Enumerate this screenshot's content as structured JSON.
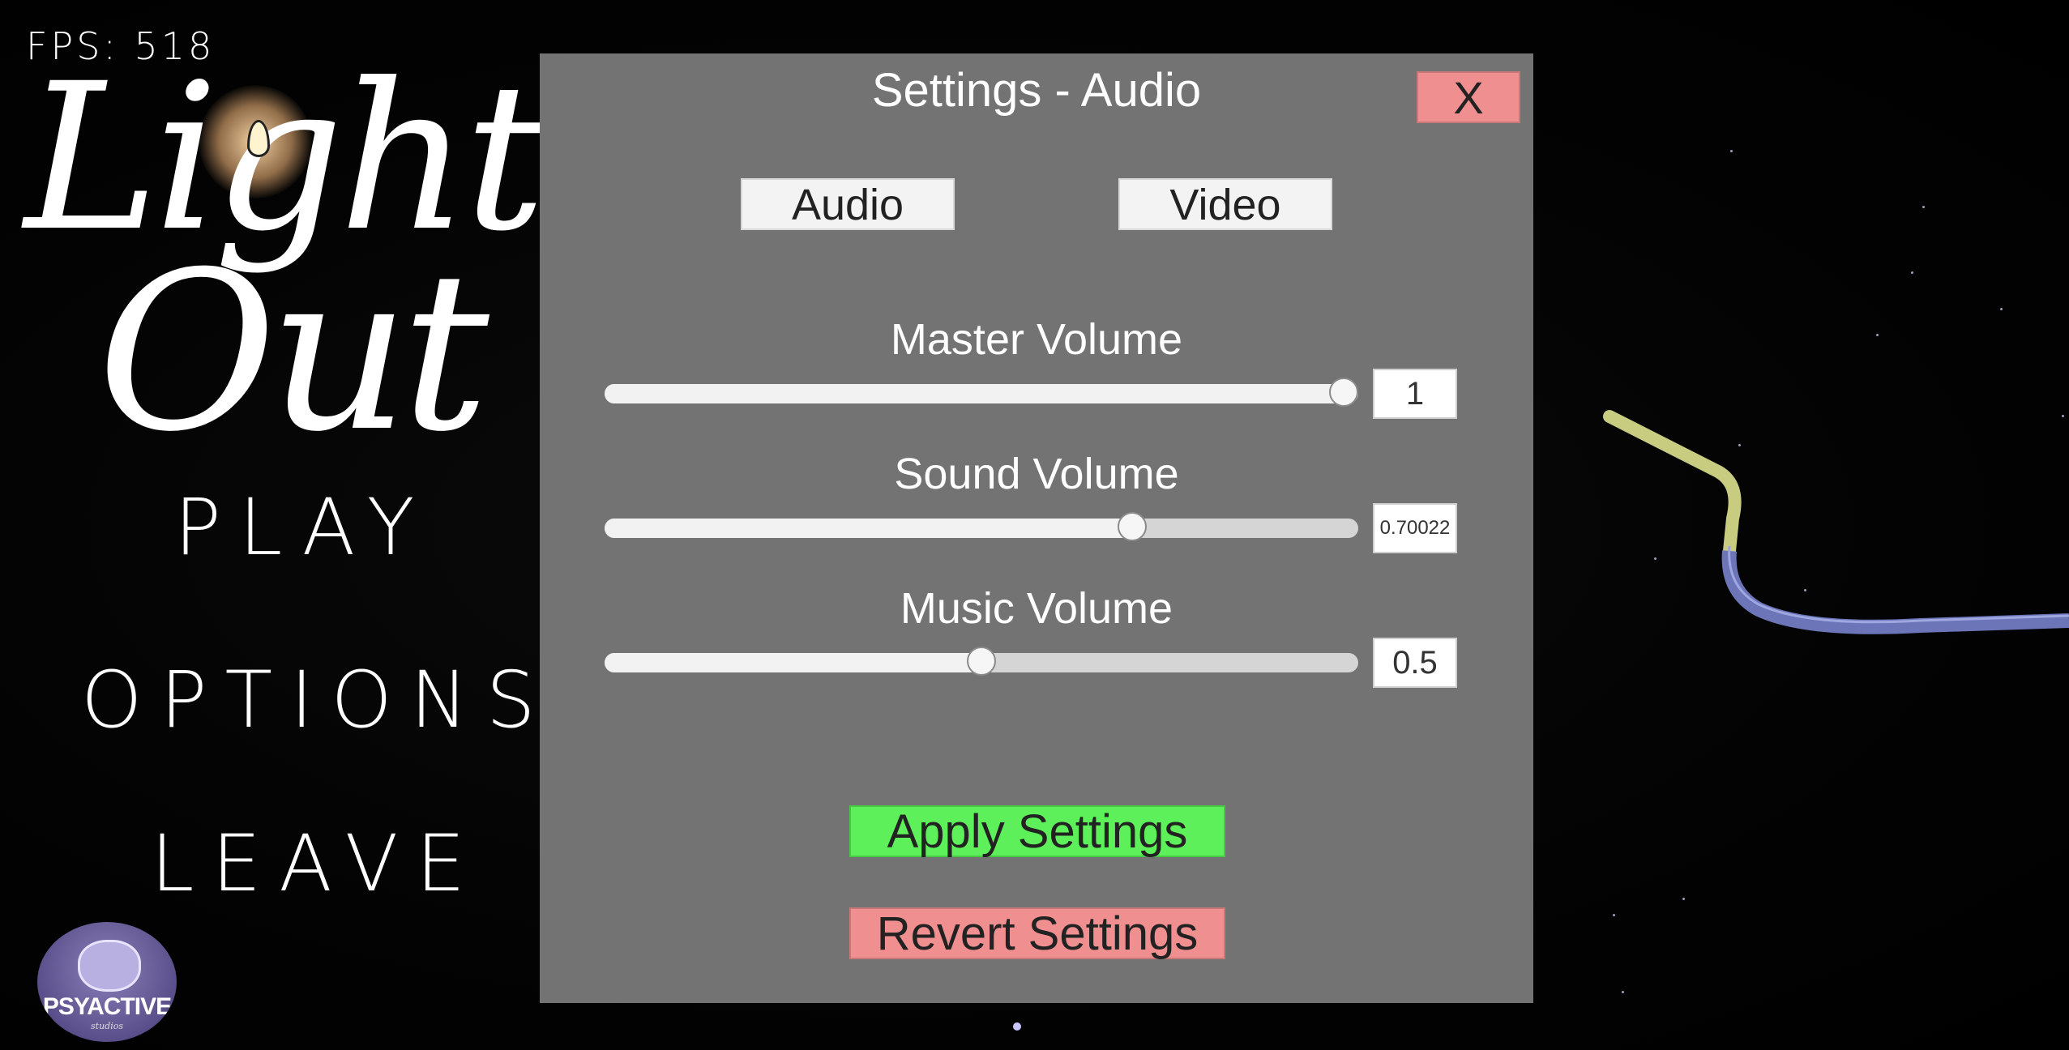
{
  "hud": {
    "fps": "FPS: 518"
  },
  "title": {
    "line1": "Lights",
    "line2": "Out"
  },
  "main_menu": {
    "play": "PLAY",
    "options": "OPTIONS",
    "leave": "LEAVE"
  },
  "studio": {
    "name": "PSYACTIVE",
    "sub": "studios"
  },
  "settings": {
    "title": "Settings - Audio",
    "close_label": "X",
    "tabs": [
      {
        "label": "Audio",
        "active": true
      },
      {
        "label": "Video",
        "active": false
      }
    ],
    "sliders": [
      {
        "label": "Master Volume",
        "value_text": "1",
        "value": 1.0
      },
      {
        "label": "Sound Volume",
        "value_text": "0.70022",
        "value": 0.70022
      },
      {
        "label": "Music Volume",
        "value_text": "0.5",
        "value": 0.5
      }
    ],
    "apply_label": "Apply Settings",
    "revert_label": "Revert Settings"
  },
  "colors": {
    "panel": "#737373",
    "close": "#f08f8f",
    "apply": "#5ef05a",
    "revert": "#f08f8f",
    "cable_tip": "#c8cc80",
    "cable_body": "#6c75b8"
  }
}
